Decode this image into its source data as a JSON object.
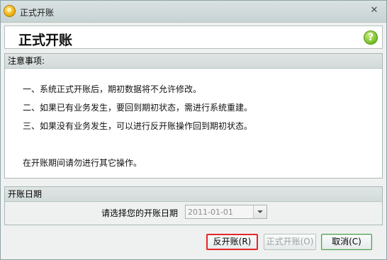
{
  "window": {
    "title": "正式开账",
    "close_symbol": "✕"
  },
  "header": {
    "title": "正式开账",
    "help_symbol": "?"
  },
  "notes": {
    "heading": "注意事项:",
    "lines": [
      "一、系统正式开账后，期初数据将不允许修改。",
      "二、如果已有业务发生，要回到期初状态，需进行系统重建。",
      "三、如果没有业务发生，可以进行反开账操作回到期初状态。",
      "在开账期间请勿进行其它操作。"
    ]
  },
  "date_section": {
    "heading": "开账日期",
    "label": "请选择您的开账日期",
    "value": "2011-01-01"
  },
  "buttons": {
    "reverse": "反开账(R)",
    "formal": "正式开账(O)",
    "cancel": "取消(C)"
  }
}
